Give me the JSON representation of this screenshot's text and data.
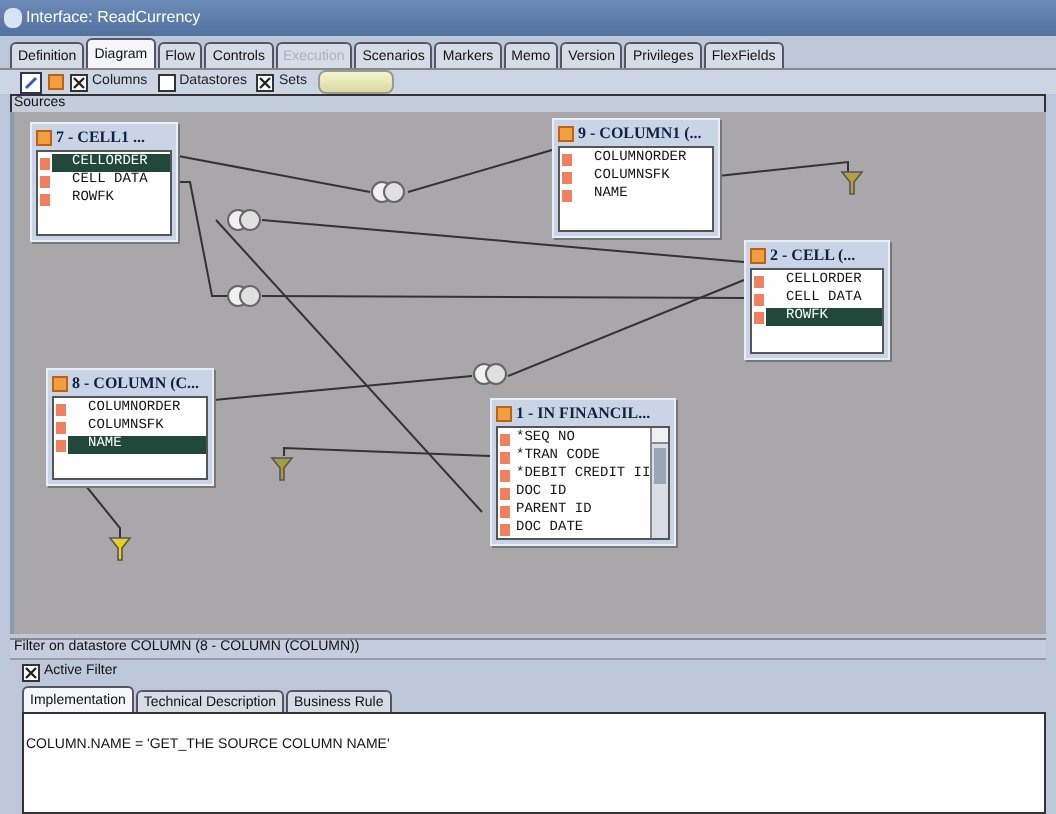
{
  "window": {
    "title": "Interface: ReadCurrency"
  },
  "tabs": [
    {
      "label": "Definition",
      "selected": false,
      "disabled": false
    },
    {
      "label": "Diagram",
      "selected": true,
      "disabled": false
    },
    {
      "label": "Flow",
      "selected": false,
      "disabled": false
    },
    {
      "label": "Controls",
      "selected": false,
      "disabled": false
    },
    {
      "label": "Execution",
      "selected": false,
      "disabled": true
    },
    {
      "label": "Scenarios",
      "selected": false,
      "disabled": false
    },
    {
      "label": "Markers",
      "selected": false,
      "disabled": false
    },
    {
      "label": "Memo",
      "selected": false,
      "disabled": false
    },
    {
      "label": "Version",
      "selected": false,
      "disabled": false
    },
    {
      "label": "Privileges",
      "selected": false,
      "disabled": false
    },
    {
      "label": "FlexFields",
      "selected": false,
      "disabled": false
    }
  ],
  "toolbar": {
    "checkboxes": [
      {
        "label": "Columns",
        "checked": true
      },
      {
        "label": "Datastores",
        "checked": false
      },
      {
        "label": "Sets",
        "checked": true
      }
    ]
  },
  "sources": {
    "label": "Sources",
    "datastores": [
      {
        "title": "7 - CELL1 ...",
        "rows": [
          {
            "name": "CELLORDER",
            "selected": true
          },
          {
            "name": "CELL DATA",
            "selected": false
          },
          {
            "name": "ROWFK",
            "selected": false
          }
        ]
      },
      {
        "title": "9 - COLUMN1 (...",
        "rows": [
          {
            "name": "COLUMNORDER",
            "selected": false
          },
          {
            "name": "COLUMNSFK",
            "selected": false
          },
          {
            "name": "NAME",
            "selected": false
          }
        ]
      },
      {
        "title": "2 - CELL (...",
        "rows": [
          {
            "name": "CELLORDER",
            "selected": false
          },
          {
            "name": "CELL DATA",
            "selected": false
          },
          {
            "name": "ROWFK",
            "selected": true
          }
        ]
      },
      {
        "title": "8 - COLUMN (C...",
        "rows": [
          {
            "name": "COLUMNORDER",
            "selected": false
          },
          {
            "name": "COLUMNSFK",
            "selected": false
          },
          {
            "name": "NAME",
            "selected": true
          }
        ]
      },
      {
        "title": "1 - IN FINANCIL...",
        "rows": [
          {
            "name": "*SEQ NO",
            "selected": false
          },
          {
            "name": "*TRAN CODE",
            "selected": false
          },
          {
            "name": "*DEBIT CREDIT II",
            "selected": false
          },
          {
            "name": "DOC ID",
            "selected": false
          },
          {
            "name": "PARENT ID",
            "selected": false
          },
          {
            "name": "DOC DATE",
            "selected": false
          }
        ]
      }
    ]
  },
  "filter": {
    "title": "Filter on datastore COLUMN (8 - COLUMN (COLUMN))",
    "active_filter": {
      "label": "Active Filter",
      "checked": true
    },
    "tabs": [
      {
        "label": "Implementation",
        "selected": true
      },
      {
        "label": "Technical Description",
        "selected": false
      },
      {
        "label": "Business Rule",
        "selected": false
      }
    ],
    "expression": "COLUMN.NAME = 'GET_THE SOURCE COLUMN NAME'"
  }
}
